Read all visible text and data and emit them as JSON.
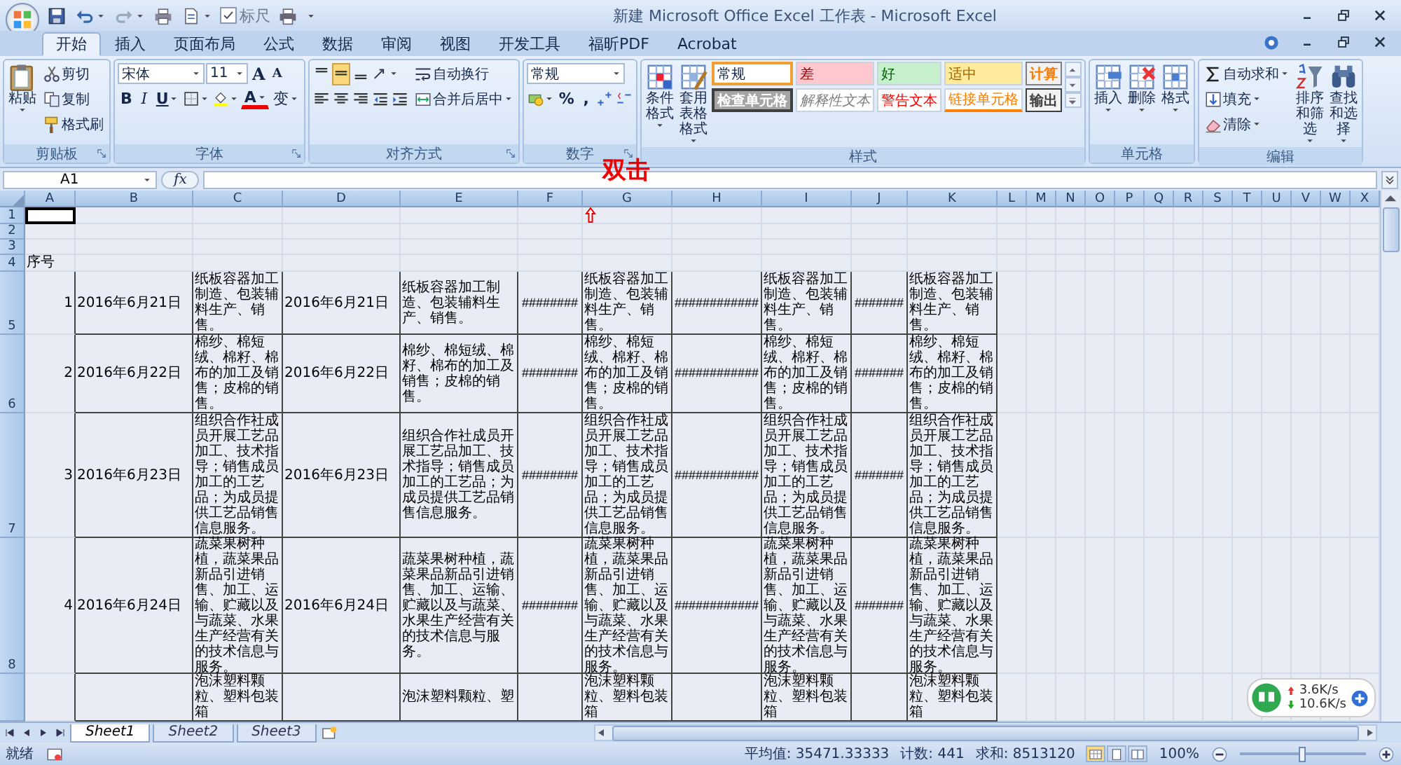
{
  "title_bar": {
    "title": "新建 Microsoft Office Excel 工作表 - Microsoft Excel",
    "ruler_checkbox": {
      "label": "标尺",
      "checked": true
    }
  },
  "ribbon_tabs": [
    {
      "label": "开始",
      "selected": true
    },
    {
      "label": "插入",
      "selected": false
    },
    {
      "label": "页面布局",
      "selected": false
    },
    {
      "label": "公式",
      "selected": false
    },
    {
      "label": "数据",
      "selected": false
    },
    {
      "label": "审阅",
      "selected": false
    },
    {
      "label": "视图",
      "selected": false
    },
    {
      "label": "开发工具",
      "selected": false
    },
    {
      "label": "福昕PDF",
      "selected": false
    },
    {
      "label": "Acrobat",
      "selected": false
    }
  ],
  "ribbon_groups": [
    {
      "title": "剪贴板",
      "launcher": true,
      "columns": [
        {
          "kind": "large",
          "label": "粘贴",
          "dropdown": true
        },
        {
          "kind": "stack",
          "rows": [
            {
              "items": [
                {
                  "kind": "small",
                  "label": "剪切"
                }
              ]
            },
            {
              "items": [
                {
                  "kind": "small",
                  "label": "复制"
                }
              ]
            },
            {
              "items": [
                {
                  "kind": "small",
                  "label": "格式刷"
                }
              ]
            }
          ]
        }
      ]
    },
    {
      "title": "字体",
      "launcher": true,
      "columns": [
        {
          "kind": "stack",
          "rows": [
            {
              "items": [
                {
                  "kind": "font-field",
                  "value": "宋体"
                },
                {
                  "kind": "size-field",
                  "value": "11"
                },
                {
                  "kind": "grow",
                  "label": "A"
                },
                {
                  "kind": "shrink",
                  "label": "A"
                }
              ]
            },
            {
              "items": [
                {
                  "kind": "bold",
                  "label": "B"
                },
                {
                  "kind": "italic",
                  "label": "I"
                },
                {
                  "kind": "underline",
                  "label": "U",
                  "dropdown": true
                },
                {
                  "kind": "icon",
                  "dropdown": true
                },
                {
                  "kind": "icon",
                  "dropdown": true
                },
                {
                  "kind": "font-color",
                  "label": "A",
                  "dropdown": true
                },
                {
                  "kind": "phonetic",
                  "label": "变",
                  "dropdown": true
                }
              ]
            }
          ]
        }
      ]
    },
    {
      "title": "对齐方式",
      "launcher": true,
      "columns": [
        {
          "kind": "stack",
          "rows": [
            {
              "items": [
                {
                  "kind": "icon",
                  "selected": false
                },
                {
                  "kind": "icon",
                  "selected": true
                },
                {
                  "kind": "icon",
                  "selected": false
                },
                {
                  "kind": "icon",
                  "dropdown": true
                }
              ]
            },
            {
              "items": [
                {
                  "kind": "icon",
                  "selected": false
                },
                {
                  "kind": "icon",
                  "selected": false
                },
                {
                  "kind": "icon",
                  "selected": false
                },
                {
                  "kind": "icon"
                },
                {
                  "kind": "icon"
                }
              ]
            }
          ]
        },
        {
          "kind": "stack",
          "rows": [
            {
              "items": [
                {
                  "kind": "small",
                  "label": "自动换行"
                }
              ]
            },
            {
              "items": [
                {
                  "kind": "small",
                  "label": "合并后居中",
                  "dropdown": true
                }
              ]
            }
          ]
        }
      ]
    },
    {
      "title": "数字",
      "launcher": true,
      "columns": [
        {
          "kind": "stack",
          "rows": [
            {
              "items": [
                {
                  "kind": "combo",
                  "value": "常规"
                }
              ]
            },
            {
              "items": [
                {
                  "kind": "icon",
                  "dropdown": true
                },
                {
                  "kind": "glyph",
                  "label": "%"
                },
                {
                  "kind": "glyph",
                  "label": ","
                },
                {
                  "kind": "icon"
                },
                {
                  "kind": "icon"
                }
              ]
            }
          ]
        }
      ]
    },
    {
      "title": "样式",
      "launcher": false,
      "columns": [
        {
          "kind": "large",
          "label": "条件格式",
          "dropdown": true
        },
        {
          "kind": "large",
          "label": "套用表格格式",
          "dropdown": true
        },
        {
          "kind": "gallery",
          "styles": [
            {
              "kind": "normal",
              "label": "常规",
              "selected": true
            },
            {
              "kind": "bad",
              "label": "差",
              "selected": false
            },
            {
              "kind": "good",
              "label": "好",
              "selected": false
            },
            {
              "kind": "neutral",
              "label": "适中",
              "selected": false
            },
            {
              "kind": "calculation",
              "label": "计算",
              "selected": false
            },
            {
              "kind": "check",
              "label": "检查单元格",
              "selected": false
            },
            {
              "kind": "explanatory",
              "label": "解释性文本",
              "selected": false
            },
            {
              "kind": "warning",
              "label": "警告文本",
              "selected": false
            },
            {
              "kind": "linked",
              "label": "链接单元格",
              "selected": false
            },
            {
              "kind": "output",
              "label": "输出",
              "selected": false
            }
          ]
        }
      ]
    },
    {
      "title": "单元格",
      "launcher": false,
      "columns": [
        {
          "kind": "large",
          "label": "插入",
          "dropdown": true
        },
        {
          "kind": "large",
          "label": "删除",
          "dropdown": true
        },
        {
          "kind": "large",
          "label": "格式",
          "dropdown": true
        }
      ]
    },
    {
      "title": "编辑",
      "launcher": false,
      "columns": [
        {
          "kind": "stack",
          "rows": [
            {
              "items": [
                {
                  "kind": "small",
                  "label": "自动求和",
                  "dropdown": true
                }
              ]
            },
            {
              "items": [
                {
                  "kind": "small",
                  "label": "填充",
                  "dropdown": true
                }
              ]
            },
            {
              "items": [
                {
                  "kind": "small",
                  "label": "清除",
                  "dropdown": true
                }
              ]
            }
          ]
        },
        {
          "kind": "large",
          "label": "排序和筛选",
          "dropdown": true
        },
        {
          "kind": "large",
          "label": "查找和选择",
          "dropdown": true
        }
      ]
    }
  ],
  "formula_bar": {
    "name_box": "A1",
    "function_button": "fx"
  },
  "annotation": {
    "text": "双击"
  },
  "sheet": {
    "columns": [
      "A",
      "B",
      "C",
      "D",
      "E",
      "F",
      "G",
      "H",
      "I",
      "J",
      "K",
      "L",
      "M",
      "N",
      "O",
      "P",
      "Q",
      "R",
      "S",
      "T",
      "U",
      "V",
      "W",
      "X"
    ],
    "rows": [
      {
        "label": "1",
        "bordered": false,
        "cells": {
          "A": {
            "selected": true
          }
        }
      },
      {
        "label": "2",
        "bordered": false,
        "cells": {}
      },
      {
        "label": "3",
        "bordered": false,
        "cells": {}
      },
      {
        "label": "4",
        "bordered": false,
        "cells": {
          "A": "序号"
        }
      },
      {
        "label": "5",
        "bordered": true,
        "cells": {
          "A": "1",
          "B": "2016年6月21日",
          "C": "纸板容器加工制造、包装辅料生产、销售。",
          "D": "2016年6月21日",
          "E": "纸板容器加工制造、包装辅料生产、销售。",
          "F": "########",
          "G": "纸板容器加工制造、包装辅料生产、销售。",
          "H": "############",
          "I": "纸板容器加工制造、包装辅料生产、销售。",
          "J": "#######",
          "K": "纸板容器加工制造、包装辅料生产、销售。"
        }
      },
      {
        "label": "6",
        "bordered": true,
        "cells": {
          "A": "2",
          "B": "2016年6月22日",
          "C": "棉纱、棉短绒、棉籽、棉布的加工及销售；皮棉的销售。",
          "D": "2016年6月22日",
          "E": "棉纱、棉短绒、棉籽、棉布的加工及销售；皮棉的销售。",
          "F": "########",
          "G": "棉纱、棉短绒、棉籽、棉布的加工及销售；皮棉的销售。",
          "H": "############",
          "I": "棉纱、棉短绒、棉籽、棉布的加工及销售；皮棉的销售。",
          "J": "#######",
          "K": "棉纱、棉短绒、棉籽、棉布的加工及销售；皮棉的销售。"
        }
      },
      {
        "label": "7",
        "bordered": true,
        "cells": {
          "A": "3",
          "B": "2016年6月23日",
          "C": "组织合作社成员开展工艺品加工、技术指导；销售成员加工的工艺品；为成员提供工艺品销售信息服务。",
          "D": "2016年6月23日",
          "E": "组织合作社成员开展工艺品加工、技术指导；销售成员加工的工艺品；为成员提供工艺品销售信息服务。",
          "F": "########",
          "G": "组织合作社成员开展工艺品加工、技术指导；销售成员加工的工艺品；为成员提供工艺品销售信息服务。",
          "H": "############",
          "I": "组织合作社成员开展工艺品加工、技术指导；销售成员加工的工艺品；为成员提供工艺品销售信息服务。",
          "J": "#######",
          "K": "组织合作社成员开展工艺品加工、技术指导；销售成员加工的工艺品；为成员提供工艺品销售信息服务。"
        }
      },
      {
        "label": "8",
        "bordered": true,
        "cells": {
          "A": "4",
          "B": "2016年6月24日",
          "C": "蔬菜果树种植，蔬菜果品新品引进销售、加工、运输、贮藏以及与蔬菜、水果生产经营有关的技术信息与服务。",
          "D": "2016年6月24日",
          "E": "蔬菜果树种植，蔬菜果品新品引进销售、加工、运输、贮藏以及与蔬菜、水果生产经营有关的技术信息与服务。",
          "F": "########",
          "G": "蔬菜果树种植，蔬菜果品新品引进销售、加工、运输、贮藏以及与蔬菜、水果生产经营有关的技术信息与服务。",
          "H": "############",
          "I": "蔬菜果树种植，蔬菜果品新品引进销售、加工、运输、贮藏以及与蔬菜、水果生产经营有关的技术信息与服务。",
          "J": "#######",
          "K": "蔬菜果树种植，蔬菜果品新品引进销售、加工、运输、贮藏以及与蔬菜、水果生产经营有关的技术信息与服务。"
        }
      },
      {
        "bordered": true,
        "cells": {
          "C": "泡沫塑料颗粒、塑料包装箱",
          "E": "泡沫塑料颗粒、塑",
          "G": "泡沫塑料颗粒、塑料包装箱",
          "I": "泡沫塑料颗粒、塑料包装箱",
          "K": "泡沫塑料颗粒、塑料包装箱"
        }
      }
    ]
  },
  "sheet_tabs": [
    {
      "label": "Sheet1",
      "selected": true
    },
    {
      "label": "Sheet2",
      "selected": false
    },
    {
      "label": "Sheet3",
      "selected": false
    }
  ],
  "status_bar": {
    "mode": "就绪",
    "average": "平均值: 35471.33333",
    "count": "计数: 441",
    "sum": "求和: 8513120",
    "zoom": "100%",
    "zoom_slider": {
      "level": 0.5
    }
  },
  "network_widget": {
    "upload": "3.6K/s",
    "download": "10.6K/s"
  }
}
